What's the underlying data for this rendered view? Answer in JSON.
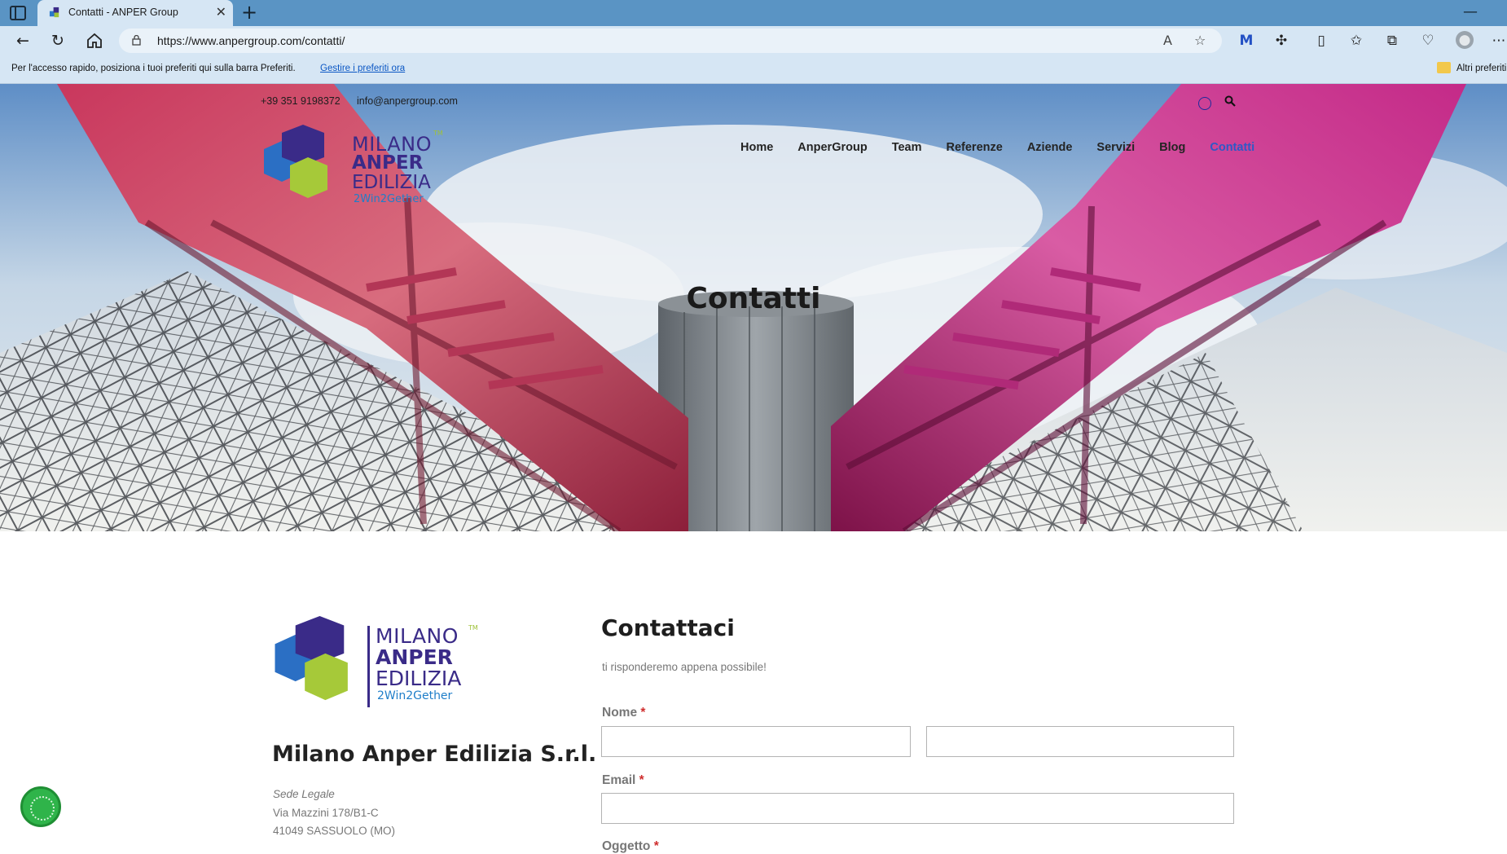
{
  "browser": {
    "tab_title": "Contatti - ANPER Group",
    "new_tab_symbol": "+",
    "url": "https://www.anpergroup.com/contatti/",
    "favorites_message": "Per l'accesso rapido, posiziona i tuoi preferiti qui sulla barra Preferiti.",
    "favorites_link": "Gestire i preferiti ora",
    "other_favorites": "Altri preferiti"
  },
  "topbar": {
    "phone": "+39 351 9198372",
    "email": "info@anpergroup.com"
  },
  "logo": {
    "line1": "MILANO",
    "line2": "ANPER",
    "line3": "EDILIZIA",
    "line4": "2Win2Gether",
    "tm": "TM"
  },
  "menu": {
    "items": [
      {
        "label": "Home"
      },
      {
        "label": "AnperGroup"
      },
      {
        "label": "Team"
      },
      {
        "label": "Referenze"
      },
      {
        "label": "Aziende"
      },
      {
        "label": "Servizi"
      },
      {
        "label": "Blog"
      },
      {
        "label": "Contatti"
      }
    ],
    "active_color": "#2d59c7"
  },
  "hero": {
    "title": "Contatti"
  },
  "company": {
    "name": "Milano Anper Edilizia S.r.l.",
    "sede_label": "Sede Legale",
    "address_line1": "Via Mazzini 178/B1-C",
    "address_line2": "41049 SASSUOLO (MO)"
  },
  "form": {
    "heading": "Contattaci",
    "subtitle": "ti risponderemo appena possibile!",
    "name_label": "Nome",
    "email_label": "Email",
    "subject_label": "Oggetto",
    "required_mark": "*",
    "first_name_value": "",
    "last_name_value": "",
    "email_value": ""
  },
  "colors": {
    "chrome_tabbar": "#5a94c4",
    "chrome_toolbar": "#d6e6f4",
    "brand_purple": "#3a2b88",
    "brand_green": "#9fc238",
    "brand_blue": "#1f7ec9",
    "required": "#cf2e2e"
  }
}
